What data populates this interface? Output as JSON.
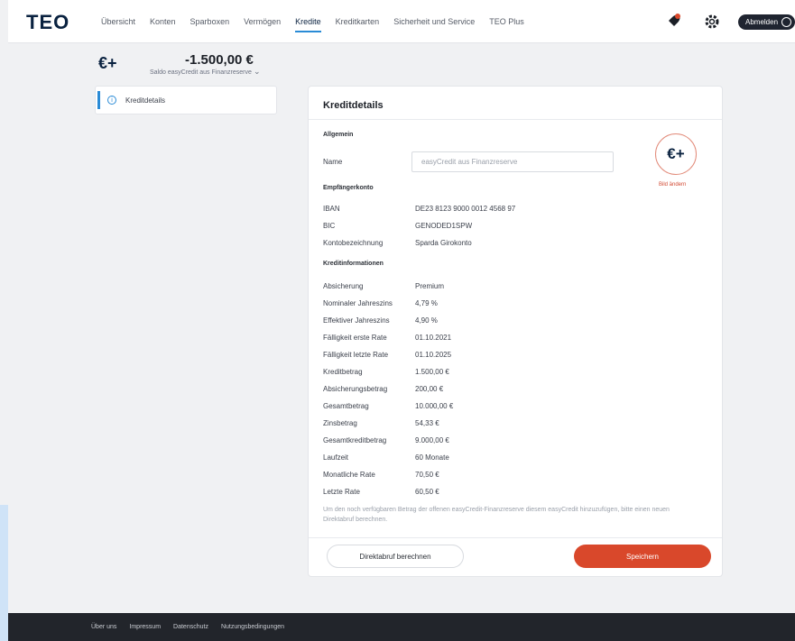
{
  "header": {
    "logo": "TEO",
    "nav": [
      "Übersicht",
      "Konten",
      "Sparboxen",
      "Vermögen",
      "Kredite",
      "Kreditkarten",
      "Sicherheit und Service",
      "TEO Plus"
    ],
    "active_index": 4,
    "logout_label": "Abmelden",
    "icons": [
      "rocket-icon",
      "gear-icon",
      "power-icon"
    ]
  },
  "account": {
    "icon": "€+",
    "amount": "-1.500,00 €",
    "subtitle": "Saldo easyCredit aus Finanzreserve",
    "chevron": "⌄"
  },
  "sidenav": {
    "item_label": "Kreditdetails",
    "icon": "info-icon"
  },
  "card": {
    "title": "Kreditdetails",
    "sections": {
      "general": "Allgemein",
      "recipient": "Empfängerkonto",
      "credit_info": "Kreditinformationen"
    },
    "name_label": "Name",
    "name_value": "easyCredit aus Finanzreserve",
    "avatar_symbol": "€+",
    "avatar_link": "Bild ändern",
    "recipient_rows": [
      {
        "label": "IBAN",
        "value": "DE23 8123 9000 0012 4568 97"
      },
      {
        "label": "BIC",
        "value": "GENODED1SPW"
      },
      {
        "label": "Kontobezeichnung",
        "value": "Sparda Girokonto"
      }
    ],
    "credit_rows": [
      {
        "label": "Absicherung",
        "value": "Premium"
      },
      {
        "label": "Nominaler Jahreszins",
        "value": "4,79 %"
      },
      {
        "label": "Effektiver Jahreszins",
        "value": "4,90 %"
      },
      {
        "label": "Fälligkeit erste Rate",
        "value": "01.10.2021"
      },
      {
        "label": "Fälligkeit letzte Rate",
        "value": "01.10.2025"
      },
      {
        "label": "Kreditbetrag",
        "value": "1.500,00 €"
      },
      {
        "label": "Absicherungsbetrag",
        "value": "200,00 €"
      },
      {
        "label": "Gesamtbetrag",
        "value": "10.000,00 €"
      },
      {
        "label": "Zinsbetrag",
        "value": "54,33 €"
      },
      {
        "label": "Gesamtkreditbetrag",
        "value": "9.000,00 €"
      },
      {
        "label": "Laufzeit",
        "value": "60 Monate"
      },
      {
        "label": "Monatliche Rate",
        "value": "70,50 €"
      },
      {
        "label": "Letzte Rate",
        "value": "60,50 €"
      }
    ],
    "note": "Um den noch verfügbaren Betrag der offenen easyCredit-Finanzreserve diesem easyCredit hinzuzufügen, bitte einen neuen Direktabruf berechnen.",
    "btn_secondary": "Direktabruf berechnen",
    "btn_primary": "Speichern"
  },
  "footer": {
    "links": [
      "Über uns",
      "Impressum",
      "Datenschutz",
      "Nutzungsbedingungen"
    ]
  },
  "colors": {
    "brand_navy": "#0a2240",
    "accent_blue": "#2a8bd6",
    "primary_red": "#d9482b"
  }
}
